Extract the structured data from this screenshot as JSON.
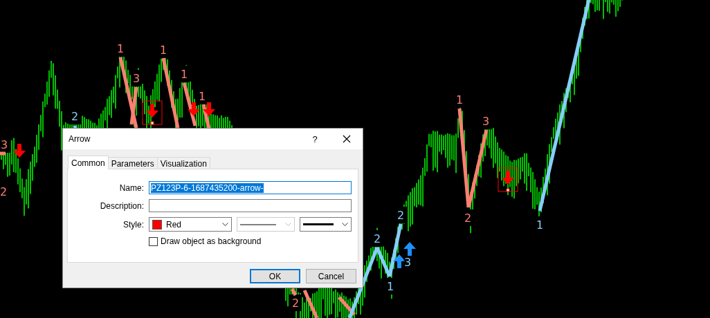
{
  "chart": {
    "wave_labels": [
      {
        "label": "3",
        "color": "#fa8072"
      },
      {
        "label": "2",
        "color": "#fa8072"
      },
      {
        "label": "2",
        "color": "#87cefa"
      },
      {
        "label": "1",
        "color": "#fa8072"
      },
      {
        "label": "3",
        "color": "#fa8072"
      },
      {
        "label": "1",
        "color": "#fa8072"
      },
      {
        "label": "1",
        "color": "#fa8072"
      },
      {
        "label": "1",
        "color": "#fa8072"
      },
      {
        "label": "2",
        "color": "#fa8072"
      },
      {
        "label": "2",
        "color": "#87cefa"
      },
      {
        "label": "2",
        "color": "#87cefa"
      },
      {
        "label": "3",
        "color": "#87cefa"
      },
      {
        "label": "1",
        "color": "#87cefa"
      },
      {
        "label": "1",
        "color": "#fa8072"
      },
      {
        "label": "3",
        "color": "#fa8072"
      },
      {
        "label": "2",
        "color": "#fa8072"
      },
      {
        "label": "1",
        "color": "#87cefa"
      }
    ]
  },
  "dialog": {
    "title": "Arrow",
    "help": "?",
    "tabs": [
      {
        "label": "Common",
        "selected": true
      },
      {
        "label": "Parameters",
        "selected": false
      },
      {
        "label": "Visualization",
        "selected": false
      }
    ],
    "fields": [
      {
        "label": "Name:",
        "value": "PZ123P-6-1687435200-arrow-",
        "text_selected": true
      },
      {
        "label": "Description:"
      }
    ],
    "style": {
      "label": "Style:",
      "color": {
        "name": "Red",
        "color": "#ff0000"
      },
      "line_style": {
        "disabled": true
      },
      "line_width": {
        "disabled": false
      }
    },
    "checkbox": {
      "label": "Draw object as background",
      "checked": false
    },
    "buttons": [
      {
        "label": "OK",
        "default": true
      },
      {
        "label": "Cancel",
        "default": false
      }
    ]
  }
}
